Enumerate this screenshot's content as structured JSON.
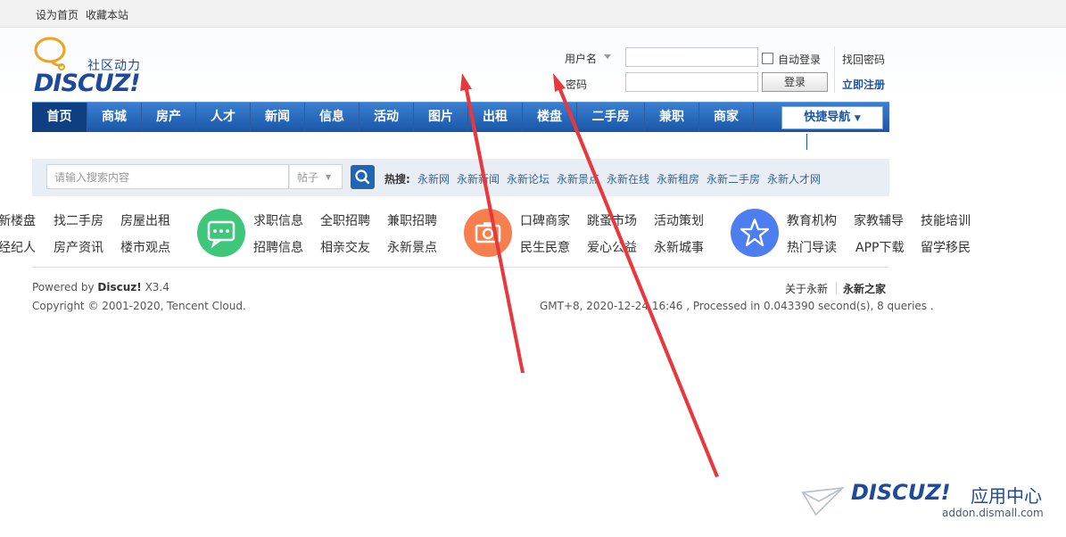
{
  "topbar": {
    "set_home": "设为首页",
    "bookmark": "收藏本站"
  },
  "logo": {
    "text": "DISCUZ!",
    "slogan": "社区动力"
  },
  "login": {
    "username_label": "用户名",
    "password_label": "密码",
    "auto_login": "自动登录",
    "find_password": "找回密码",
    "login_button": "登录",
    "register": "立即注册"
  },
  "nav": {
    "items": [
      "首页",
      "商城",
      "房产",
      "人才",
      "新闻",
      "信息",
      "活动",
      "图片",
      "出租",
      "楼盘",
      "二手房",
      "兼职",
      "商家"
    ],
    "quick_nav": "快捷导航"
  },
  "search": {
    "placeholder": "请输入搜索内容",
    "type": "帖子",
    "hot_label": "热搜:",
    "hot_links": [
      "永新网",
      "永新新闻",
      "永新论坛",
      "永新景点",
      "永新在线",
      "永新租房",
      "永新二手房",
      "永新人才网"
    ]
  },
  "categories": {
    "group1_row1": [
      "新楼盘",
      "找二手房",
      "房屋出租"
    ],
    "group1_row2": [
      "经纪人",
      "房产资讯",
      "楼市观点"
    ],
    "group2_row1": [
      "求职信息",
      "全职招聘",
      "兼职招聘"
    ],
    "group2_row2": [
      "招聘信息",
      "相亲交友",
      "永新景点"
    ],
    "group3_row1": [
      "口碑商家",
      "跳蚤市场",
      "活动策划"
    ],
    "group3_row2": [
      "民生民意",
      "爱心公益",
      "永新城事"
    ],
    "group4_row1": [
      "教育机构",
      "家教辅导",
      "技能培训"
    ],
    "group4_row2": [
      "热门导读",
      "APP下载",
      "留学移民"
    ]
  },
  "footer": {
    "powered_prefix": "Powered by",
    "powered_brand": "Discuz!",
    "version": "X3.4",
    "copyright": "Copyright © 2001-2020, Tencent Cloud.",
    "about": "关于永新",
    "home": "永新之家",
    "stats": "GMT+8, 2020-12-24 16:46 , Processed in 0.043390 second(s), 8 queries ."
  },
  "watermark": {
    "brand": "DISCUZ!",
    "suffix": "应用中心",
    "url": "addon.dismall.com"
  },
  "colors": {
    "nav_blue": "#1a56a8",
    "arrow_red": "#e8383d",
    "link_blue": "#336699"
  }
}
